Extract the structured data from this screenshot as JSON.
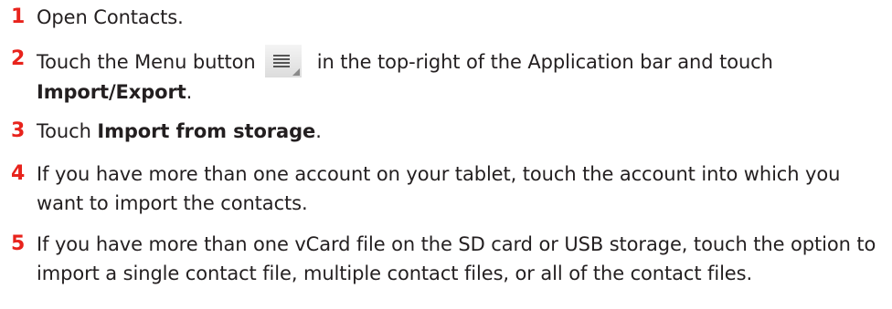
{
  "steps": [
    {
      "number": "1",
      "text": "Open Contacts."
    },
    {
      "number": "2",
      "text_before": "Touch the Menu button",
      "text_after": "in the top-right of the Application bar and touch",
      "bold": "Import/Export",
      "text_end": "."
    },
    {
      "number": "3",
      "text_before": "Touch ",
      "bold": "Import from storage",
      "text_end": "."
    },
    {
      "number": "4",
      "text": "If you have more than one account on your tablet, touch the account into which you want to import the contacts."
    },
    {
      "number": "5",
      "text": "If you have more than one vCard file on the SD card or USB storage, touch the option to import a single contact file, multiple contact files, or all of the contact files."
    }
  ],
  "icons": {
    "menu_button": "menu-icon"
  },
  "colors": {
    "step_number": "#e8231c",
    "body_text": "#231f20"
  }
}
